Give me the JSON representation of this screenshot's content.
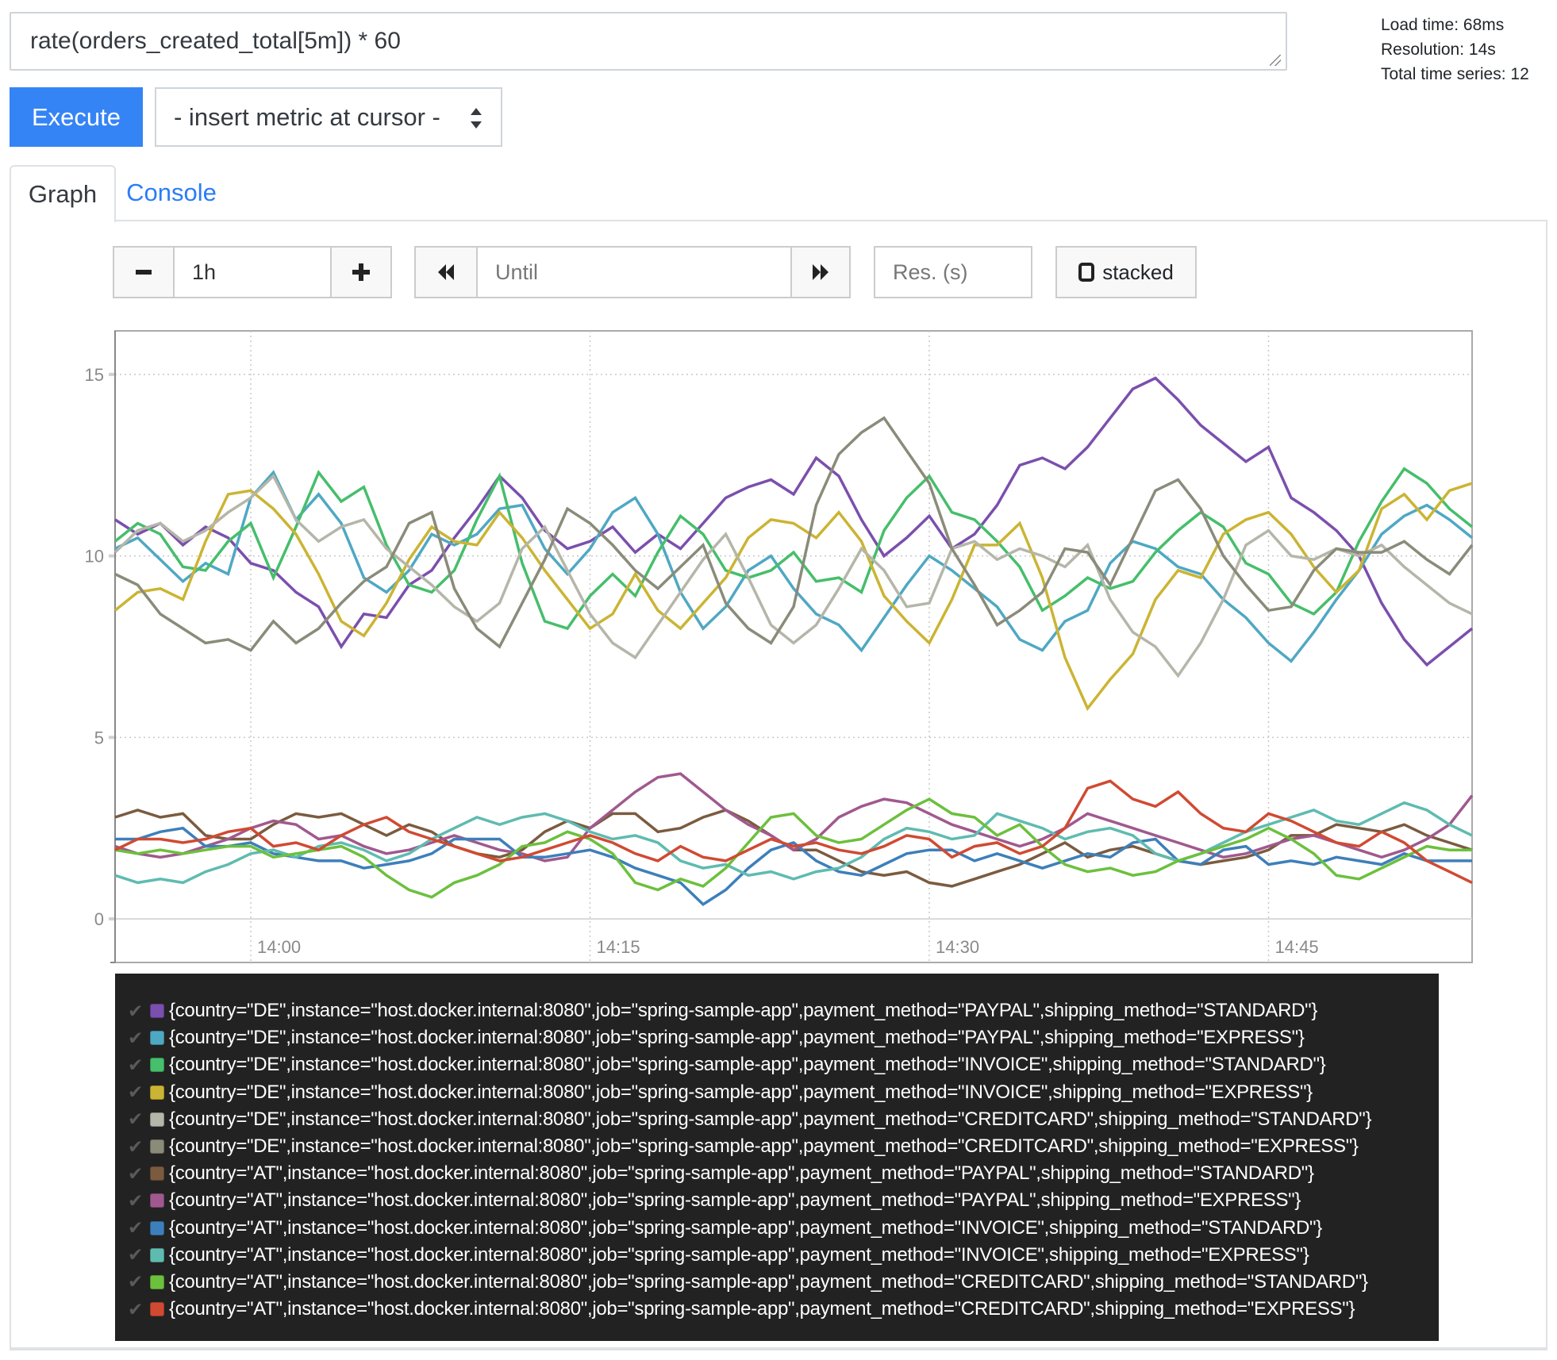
{
  "query": {
    "expression": "rate(orders_created_total[5m]) * 60"
  },
  "stats": {
    "load_time": "Load time: 68ms",
    "resolution": "Resolution: 14s",
    "total_series": "Total time series: 12"
  },
  "toolbar": {
    "execute_label": "Execute",
    "metric_select_value": "- insert metric at cursor -"
  },
  "tabs": [
    {
      "label": "Graph",
      "active": true
    },
    {
      "label": "Console",
      "active": false
    }
  ],
  "graph_controls": {
    "range_value": "1h",
    "until_placeholder": "Until",
    "resolution_placeholder": "Res. (s)",
    "stacked_label": "stacked",
    "stacked_checked": false
  },
  "chart_data": {
    "type": "line",
    "title": "",
    "xlabel": "",
    "ylabel": "",
    "x_start": "13:54",
    "x_end": "14:54",
    "x_step_minutes": 1,
    "ylim": [
      -1.2,
      16.2
    ],
    "yticks": [
      0,
      5,
      10,
      15
    ],
    "xticks": [
      {
        "label": "14:00",
        "minutes_from_start": 6
      },
      {
        "label": "14:15",
        "minutes_from_start": 21
      },
      {
        "label": "14:30",
        "minutes_from_start": 36
      },
      {
        "label": "14:45",
        "minutes_from_start": 51
      }
    ],
    "grid": true,
    "legend_position": "bottom",
    "series": [
      {
        "name": "{country=\"DE\",instance=\"host.docker.internal:8080\",job=\"spring-sample-app\",payment_method=\"PAYPAL\",shipping_method=\"STANDARD\"}",
        "color": "#7b4fad",
        "values": [
          11.0,
          10.6,
          10.9,
          10.3,
          10.8,
          10.5,
          9.8,
          9.6,
          9.0,
          8.6,
          7.5,
          8.4,
          8.3,
          9.2,
          9.6,
          10.5,
          11.3,
          12.2,
          11.6,
          10.7,
          10.2,
          10.4,
          10.8,
          10.1,
          10.6,
          10.2,
          10.9,
          11.6,
          11.9,
          12.1,
          11.7,
          12.7,
          12.2,
          11.0,
          10.0,
          10.5,
          11.1,
          10.2,
          10.6,
          11.4,
          12.5,
          12.7,
          12.4,
          13.0,
          13.8,
          14.6,
          14.9,
          14.3,
          13.6,
          13.1,
          12.6,
          13.0,
          11.6,
          11.2,
          10.7,
          10.0,
          8.7,
          7.7,
          7.0,
          7.5,
          8.0
        ]
      },
      {
        "name": "{country=\"DE\",instance=\"host.docker.internal:8080\",job=\"spring-sample-app\",payment_method=\"PAYPAL\",shipping_method=\"EXPRESS\"}",
        "color": "#4fa8c3",
        "values": [
          10.2,
          10.5,
          9.9,
          9.3,
          9.8,
          9.5,
          11.6,
          12.3,
          11.0,
          11.7,
          10.9,
          9.4,
          9.0,
          9.6,
          10.6,
          10.3,
          10.6,
          11.3,
          11.4,
          10.2,
          9.5,
          10.2,
          11.2,
          11.6,
          10.6,
          9.0,
          8.0,
          8.6,
          9.6,
          10.0,
          9.1,
          8.4,
          8.1,
          7.4,
          8.3,
          9.2,
          10.0,
          9.6,
          9.1,
          8.6,
          7.7,
          7.4,
          8.2,
          8.5,
          9.8,
          10.4,
          10.2,
          9.7,
          9.5,
          8.8,
          8.3,
          7.6,
          7.1,
          7.9,
          8.8,
          9.6,
          10.6,
          11.1,
          11.4,
          11.0,
          10.5
        ]
      },
      {
        "name": "{country=\"DE\",instance=\"host.docker.internal:8080\",job=\"spring-sample-app\",payment_method=\"INVOICE\",shipping_method=\"STANDARD\"}",
        "color": "#46be6b",
        "values": [
          10.4,
          10.9,
          10.6,
          9.7,
          9.6,
          10.4,
          10.9,
          9.4,
          10.8,
          12.3,
          11.5,
          11.9,
          10.3,
          9.2,
          9.0,
          9.6,
          11.0,
          12.2,
          9.8,
          8.2,
          8.0,
          8.9,
          9.5,
          8.9,
          10.1,
          11.1,
          10.6,
          9.6,
          9.4,
          9.6,
          10.1,
          9.3,
          9.4,
          9.0,
          10.7,
          11.6,
          12.2,
          11.2,
          11.0,
          10.4,
          9.7,
          8.5,
          8.9,
          9.4,
          9.1,
          9.3,
          10.1,
          10.7,
          11.2,
          10.8,
          9.8,
          9.5,
          8.7,
          8.4,
          9.0,
          10.4,
          11.5,
          12.4,
          12.0,
          11.3,
          10.8
        ]
      },
      {
        "name": "{country=\"DE\",instance=\"host.docker.internal:8080\",job=\"spring-sample-app\",payment_method=\"INVOICE\",shipping_method=\"EXPRESS\"}",
        "color": "#cbb433",
        "values": [
          8.5,
          9.0,
          9.1,
          8.8,
          10.4,
          11.7,
          11.8,
          11.3,
          10.6,
          9.5,
          8.2,
          7.8,
          8.7,
          9.9,
          10.8,
          10.4,
          10.3,
          11.2,
          10.5,
          9.6,
          8.8,
          8.0,
          8.4,
          9.5,
          8.5,
          8.0,
          8.7,
          9.4,
          10.5,
          11.0,
          10.9,
          10.5,
          11.2,
          10.4,
          8.9,
          8.2,
          7.6,
          8.8,
          10.3,
          10.3,
          10.9,
          9.4,
          7.2,
          5.8,
          6.6,
          7.3,
          8.8,
          9.6,
          9.4,
          10.6,
          11.0,
          11.2,
          10.6,
          9.7,
          9.0,
          9.6,
          11.3,
          11.7,
          11.0,
          11.8,
          12.0
        ]
      },
      {
        "name": "{country=\"DE\",instance=\"host.docker.internal:8080\",job=\"spring-sample-app\",payment_method=\"CREDITCARD\",shipping_method=\"STANDARD\"}",
        "color": "#b5b6a9",
        "values": [
          10.1,
          10.7,
          10.9,
          10.4,
          10.7,
          11.2,
          11.6,
          12.2,
          11.0,
          10.4,
          10.8,
          11.0,
          10.2,
          9.7,
          9.2,
          8.6,
          8.2,
          8.7,
          10.2,
          10.8,
          9.6,
          8.4,
          7.6,
          7.2,
          8.1,
          9.0,
          9.9,
          10.6,
          9.4,
          8.1,
          7.6,
          8.1,
          9.1,
          10.2,
          9.6,
          8.6,
          8.7,
          10.2,
          10.4,
          9.9,
          10.2,
          10.0,
          9.7,
          10.3,
          8.8,
          7.9,
          7.5,
          6.7,
          7.6,
          8.8,
          10.3,
          10.7,
          10.0,
          9.9,
          10.2,
          10.0,
          10.3,
          9.7,
          9.2,
          8.7,
          8.4
        ]
      },
      {
        "name": "{country=\"DE\",instance=\"host.docker.internal:8080\",job=\"spring-sample-app\",payment_method=\"CREDITCARD\",shipping_method=\"EXPRESS\"}",
        "color": "#8b8b7a",
        "values": [
          9.5,
          9.2,
          8.4,
          8.0,
          7.6,
          7.7,
          7.4,
          8.2,
          7.6,
          8.0,
          8.7,
          9.3,
          9.7,
          10.9,
          11.2,
          9.1,
          8.0,
          7.5,
          8.7,
          9.9,
          11.3,
          10.9,
          10.3,
          9.6,
          9.1,
          9.7,
          10.3,
          8.7,
          8.0,
          7.6,
          8.6,
          11.4,
          12.8,
          13.4,
          13.8,
          12.9,
          12.0,
          10.2,
          9.2,
          8.1,
          8.5,
          9.0,
          10.2,
          10.1,
          9.2,
          10.5,
          11.8,
          12.1,
          11.3,
          10.0,
          9.2,
          8.5,
          8.6,
          9.6,
          10.2,
          10.1,
          10.1,
          10.4,
          9.9,
          9.5,
          10.3
        ]
      },
      {
        "name": "{country=\"AT\",instance=\"host.docker.internal:8080\",job=\"spring-sample-app\",payment_method=\"PAYPAL\",shipping_method=\"STANDARD\"}",
        "color": "#7b5b3f",
        "values": [
          2.8,
          3.0,
          2.8,
          2.9,
          2.3,
          2.2,
          2.2,
          2.6,
          2.9,
          2.8,
          2.9,
          2.6,
          2.3,
          2.6,
          2.4,
          2.0,
          1.8,
          1.7,
          1.9,
          2.4,
          2.7,
          2.5,
          2.9,
          2.9,
          2.4,
          2.5,
          2.8,
          3.0,
          2.7,
          2.3,
          1.9,
          1.9,
          1.6,
          1.3,
          1.2,
          1.3,
          1.0,
          0.9,
          1.1,
          1.3,
          1.5,
          1.8,
          2.1,
          1.7,
          1.9,
          2.0,
          1.8,
          1.6,
          1.5,
          1.6,
          1.7,
          1.9,
          2.3,
          2.3,
          2.6,
          2.5,
          2.4,
          2.6,
          2.3,
          2.1,
          1.9
        ]
      },
      {
        "name": "{country=\"AT\",instance=\"host.docker.internal:8080\",job=\"spring-sample-app\",payment_method=\"PAYPAL\",shipping_method=\"EXPRESS\"}",
        "color": "#a0598e",
        "values": [
          2.0,
          1.8,
          1.7,
          1.8,
          2.0,
          2.2,
          2.5,
          2.7,
          2.6,
          2.2,
          2.3,
          2.0,
          1.8,
          1.9,
          2.1,
          2.3,
          2.1,
          1.9,
          1.8,
          1.6,
          1.7,
          2.5,
          3.0,
          3.5,
          3.9,
          4.0,
          3.5,
          3.0,
          2.6,
          2.3,
          1.9,
          2.2,
          2.8,
          3.1,
          3.3,
          3.2,
          2.9,
          2.6,
          2.4,
          2.2,
          2.0,
          2.2,
          2.5,
          2.9,
          2.7,
          2.5,
          2.3,
          2.1,
          1.9,
          1.7,
          1.8,
          2.0,
          2.2,
          2.3,
          2.1,
          1.9,
          1.7,
          1.9,
          2.2,
          2.6,
          3.4
        ]
      },
      {
        "name": "{country=\"AT\",instance=\"host.docker.internal:8080\",job=\"spring-sample-app\",payment_method=\"INVOICE\",shipping_method=\"STANDARD\"}",
        "color": "#3d7fba",
        "values": [
          2.2,
          2.2,
          2.4,
          2.5,
          2.0,
          2.0,
          2.1,
          1.8,
          1.7,
          1.6,
          1.6,
          1.4,
          1.5,
          1.6,
          1.8,
          2.2,
          2.2,
          2.2,
          1.7,
          1.7,
          1.8,
          1.9,
          1.7,
          1.4,
          1.2,
          1.0,
          0.4,
          0.8,
          1.4,
          1.9,
          2.1,
          1.6,
          1.3,
          1.2,
          1.5,
          1.8,
          1.9,
          1.9,
          1.6,
          1.8,
          1.6,
          1.4,
          1.6,
          1.8,
          1.7,
          2.1,
          2.2,
          1.6,
          1.5,
          1.9,
          2.0,
          1.5,
          1.6,
          1.5,
          1.7,
          1.6,
          1.5,
          1.8,
          1.6,
          1.6,
          1.6
        ]
      },
      {
        "name": "{country=\"AT\",instance=\"host.docker.internal:8080\",job=\"spring-sample-app\",payment_method=\"INVOICE\",shipping_method=\"EXPRESS\"}",
        "color": "#5fbbb0",
        "values": [
          1.2,
          1.0,
          1.1,
          1.0,
          1.3,
          1.5,
          1.8,
          1.9,
          1.7,
          2.0,
          2.1,
          1.9,
          1.6,
          1.8,
          2.2,
          2.5,
          2.8,
          2.6,
          2.8,
          2.9,
          2.7,
          2.4,
          2.2,
          2.3,
          2.1,
          1.6,
          1.4,
          1.5,
          1.2,
          1.3,
          1.1,
          1.3,
          1.4,
          1.7,
          2.2,
          2.5,
          2.4,
          2.2,
          2.3,
          2.9,
          2.7,
          2.5,
          2.2,
          2.4,
          2.5,
          2.3,
          1.8,
          1.6,
          1.8,
          2.1,
          2.4,
          2.6,
          2.8,
          3.0,
          2.7,
          2.6,
          2.9,
          3.2,
          3.0,
          2.6,
          2.3
        ]
      },
      {
        "name": "{country=\"AT\",instance=\"host.docker.internal:8080\",job=\"spring-sample-app\",payment_method=\"CREDITCARD\",shipping_method=\"STANDARD\"}",
        "color": "#6cc03d",
        "values": [
          1.9,
          1.8,
          1.9,
          1.8,
          1.9,
          2.0,
          2.0,
          1.7,
          1.8,
          1.9,
          2.0,
          1.7,
          1.2,
          0.8,
          0.6,
          1.0,
          1.2,
          1.5,
          2.0,
          2.1,
          2.4,
          2.2,
          1.8,
          1.0,
          0.8,
          1.1,
          0.9,
          1.4,
          2.1,
          2.8,
          2.9,
          2.3,
          2.1,
          2.2,
          2.6,
          3.0,
          3.3,
          2.9,
          2.8,
          2.3,
          2.6,
          2.0,
          1.5,
          1.3,
          1.4,
          1.2,
          1.3,
          1.6,
          1.8,
          2.0,
          2.2,
          2.5,
          2.2,
          1.8,
          1.2,
          1.1,
          1.4,
          1.7,
          2.0,
          1.9,
          1.9
        ]
      },
      {
        "name": "{country=\"AT\",instance=\"host.docker.internal:8080\",job=\"spring-sample-app\",payment_method=\"CREDITCARD\",shipping_method=\"EXPRESS\"}",
        "color": "#d04a32",
        "values": [
          1.9,
          2.2,
          2.2,
          2.1,
          2.2,
          2.4,
          2.5,
          2.0,
          2.1,
          1.9,
          2.3,
          2.6,
          2.8,
          2.4,
          2.2,
          2.0,
          1.8,
          1.6,
          1.7,
          1.9,
          2.1,
          2.3,
          2.1,
          1.8,
          1.6,
          2.0,
          1.7,
          1.6,
          1.9,
          2.2,
          2.0,
          2.1,
          1.9,
          1.8,
          2.0,
          2.3,
          2.2,
          1.7,
          2.0,
          2.1,
          1.8,
          2.0,
          2.5,
          3.6,
          3.8,
          3.3,
          3.1,
          3.5,
          2.9,
          2.5,
          2.4,
          2.9,
          2.7,
          2.4,
          2.1,
          2.0,
          2.4,
          2.1,
          1.6,
          1.3,
          1.0
        ]
      }
    ]
  }
}
